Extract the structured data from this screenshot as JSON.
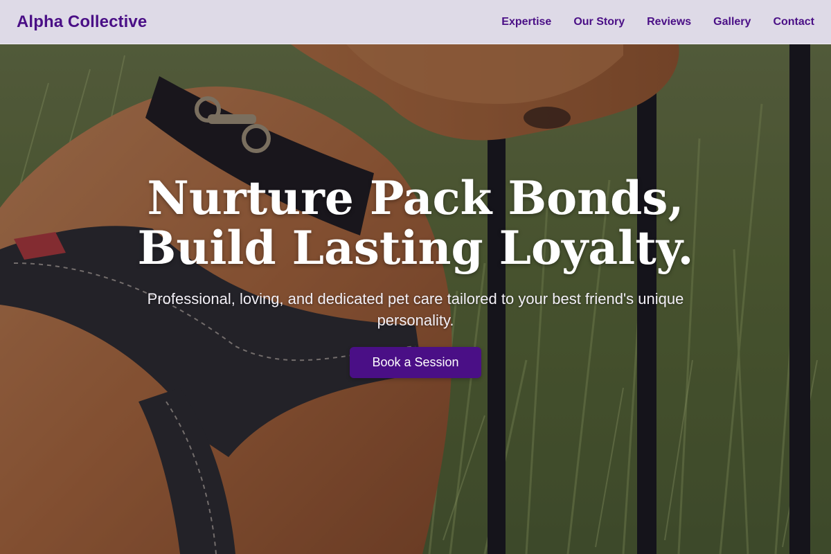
{
  "brand": {
    "name": "Alpha Collective"
  },
  "nav": {
    "items": [
      {
        "label": "Expertise"
      },
      {
        "label": "Our Story"
      },
      {
        "label": "Reviews"
      },
      {
        "label": "Gallery"
      },
      {
        "label": "Contact"
      }
    ]
  },
  "hero": {
    "title_line1": "Nurture Pack Bonds,",
    "title_line2": "Build Lasting Loyalty.",
    "subtitle": "Professional, loving, and dedicated pet care tailored to your best friend's unique personality.",
    "cta_label": "Book a Session"
  },
  "colors": {
    "brand_purple": "#4a0f86",
    "nav_background": "#e8e4f4",
    "hero_text": "#ffffff"
  }
}
